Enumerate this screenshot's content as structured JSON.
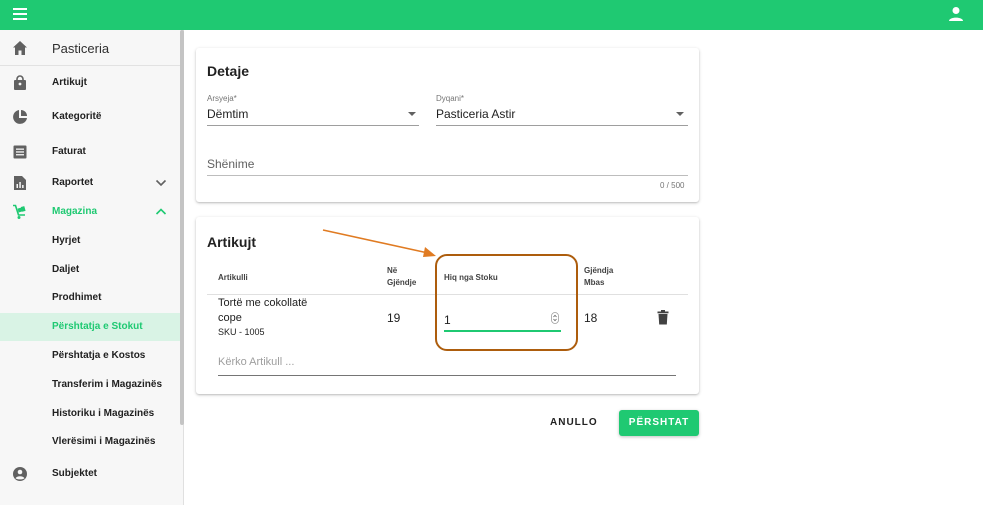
{
  "colors": {
    "accent": "#1fc972",
    "highlight": "#ad5d0d",
    "arrow": "#e07b22"
  },
  "topbar": {
    "menu_icon": "menu-icon",
    "user_icon": "account-icon"
  },
  "sidebar": {
    "home": {
      "label": "Pasticeria",
      "icon": "home-icon"
    },
    "items": [
      {
        "label": "Artikujt",
        "icon": "shopping-bag-icon"
      },
      {
        "label": "Kategoritë",
        "icon": "pie-chart-icon"
      },
      {
        "label": "Faturat",
        "icon": "receipt-icon"
      },
      {
        "label": "Raportet",
        "icon": "report-icon"
      },
      {
        "label": "Magazina",
        "icon": "warehouse-cart-icon"
      },
      {
        "label": "Subjektet",
        "icon": "account-circle-icon"
      }
    ],
    "subitems": [
      "Hyrjet",
      "Daljet",
      "Prodhimet",
      "Përshtatja e Stokut",
      "Përshtatja e Kostos",
      "Transferim i Magazinës",
      "Historiku i Magazinës",
      "Vlerësimi i Magazinës"
    ]
  },
  "details": {
    "title": "Detaje",
    "reason_label": "Arsyeja*",
    "reason_value": "Dëmtim",
    "store_label": "Dyqani*",
    "store_value": "Pasticeria Astir",
    "notes_placeholder": "Shënime",
    "notes_counter": "0 / 500"
  },
  "articles": {
    "title": "Artikujt",
    "columns": {
      "article": "Artikulli",
      "in_stock_1": "Në",
      "in_stock_2": "Gjëndje",
      "remove": "Hiq nga Stoku",
      "after_1": "Gjëndja",
      "after_2": "Mbas"
    },
    "row": {
      "name_1": "Tortë me cokollatë",
      "name_2": "cope",
      "sku": "SKU - 1005",
      "in_stock": "19",
      "remove_qty": "1",
      "after": "18"
    },
    "search_placeholder": "Kërko Artikull ..."
  },
  "actions": {
    "cancel": "ANULLO",
    "submit": "PËRSHTAT"
  }
}
